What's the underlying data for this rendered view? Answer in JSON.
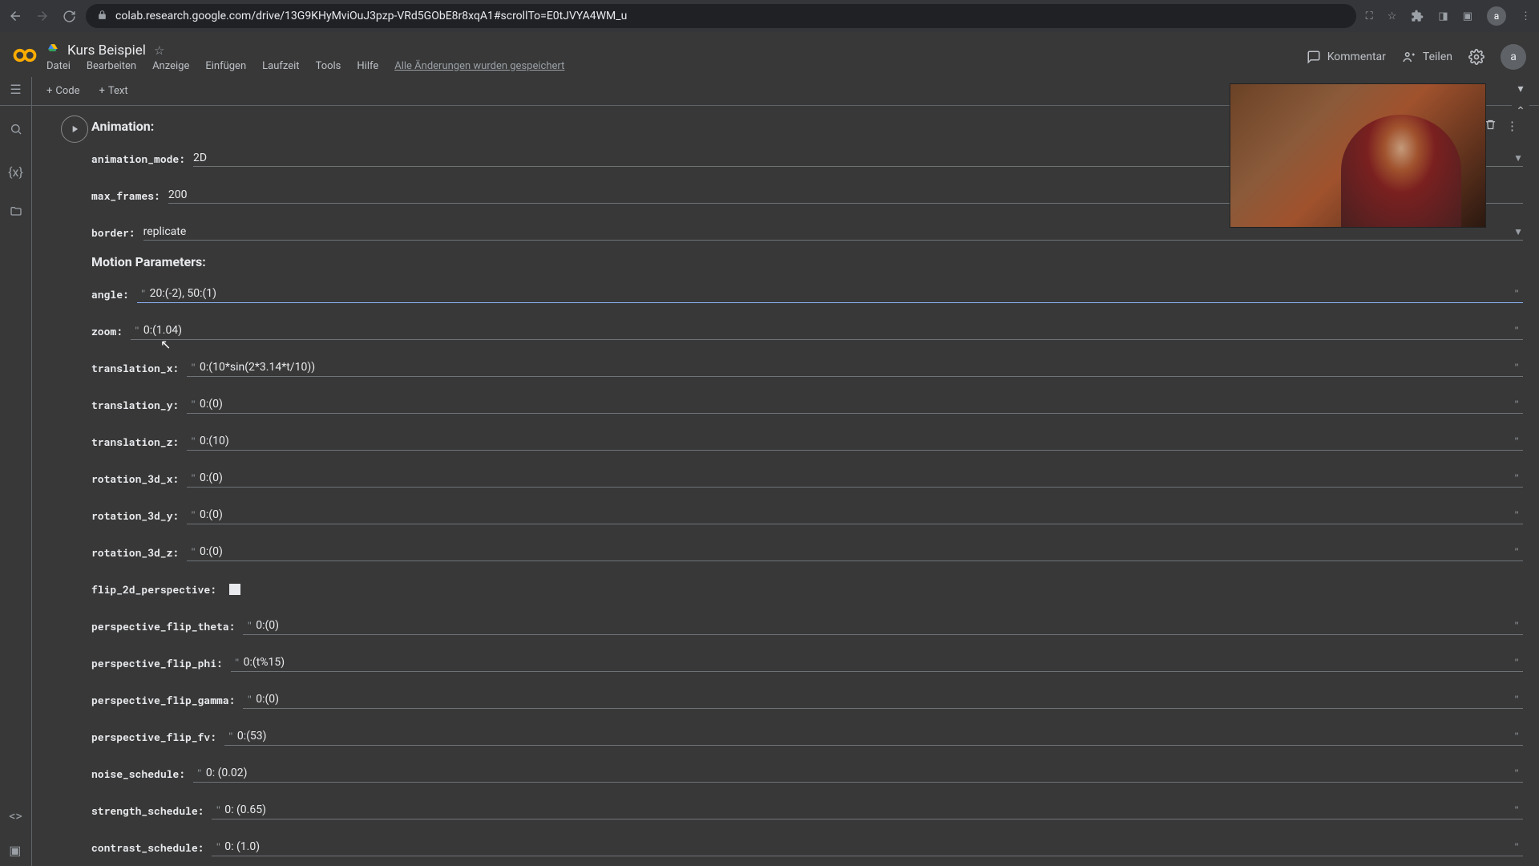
{
  "url": "colab.research.google.com/drive/13G9KHyMviOuJ3pzp-VRd5GObE8r8xqA1#scrollTo=E0tJVYA4WM_u",
  "avatar_letter": "a",
  "notebook_title": "Kurs Beispiel",
  "menu": {
    "file": "Datei",
    "edit": "Bearbeiten",
    "view": "Anzeige",
    "insert": "Einfügen",
    "runtime": "Laufzeit",
    "tools": "Tools",
    "help": "Hilfe"
  },
  "save_msg": "Alle Änderungen wurden gespeichert",
  "hdr": {
    "comment": "Kommentar",
    "share": "Teilen"
  },
  "toolbar": {
    "code": "Code",
    "text": "Text"
  },
  "sections": {
    "animation": "Animation:",
    "motion": "Motion Parameters:"
  },
  "fields": {
    "animation_mode": {
      "label": "animation_mode:",
      "value": "2D",
      "dropdown": true
    },
    "max_frames": {
      "label": "max_frames:",
      "value": "200"
    },
    "border": {
      "label": "border:",
      "value": "replicate",
      "dropdown": true
    },
    "angle": {
      "label": "angle:",
      "value": "20:(-2), 50:(1)",
      "quoted": true,
      "active": true
    },
    "zoom": {
      "label": "zoom:",
      "value": "0:(1.04)",
      "quoted": true
    },
    "translation_x": {
      "label": "translation_x:",
      "value": "0:(10*sin(2*3.14*t/10))",
      "quoted": true
    },
    "translation_y": {
      "label": "translation_y:",
      "value": "0:(0)",
      "quoted": true
    },
    "translation_z": {
      "label": "translation_z:",
      "value": "0:(10)",
      "quoted": true
    },
    "rotation_3d_x": {
      "label": "rotation_3d_x:",
      "value": "0:(0)",
      "quoted": true
    },
    "rotation_3d_y": {
      "label": "rotation_3d_y:",
      "value": "0:(0)",
      "quoted": true
    },
    "rotation_3d_z": {
      "label": "rotation_3d_z:",
      "value": "0:(0)",
      "quoted": true
    },
    "flip_2d_perspective": {
      "label": "flip_2d_perspective:",
      "checkbox": true,
      "checked": false
    },
    "perspective_flip_theta": {
      "label": "perspective_flip_theta:",
      "value": "0:(0)",
      "quoted": true
    },
    "perspective_flip_phi": {
      "label": "perspective_flip_phi:",
      "value": "0:(t%15)",
      "quoted": true
    },
    "perspective_flip_gamma": {
      "label": "perspective_flip_gamma:",
      "value": "0:(0)",
      "quoted": true
    },
    "perspective_flip_fv": {
      "label": "perspective_flip_fv:",
      "value": "0:(53)",
      "quoted": true
    },
    "noise_schedule": {
      "label": "noise_schedule:",
      "value": "0: (0.02)",
      "quoted": true
    },
    "strength_schedule": {
      "label": "strength_schedule:",
      "value": "0: (0.65)",
      "quoted": true
    },
    "contrast_schedule": {
      "label": "contrast_schedule:",
      "value": "0: (1.0)",
      "quoted": true
    }
  }
}
